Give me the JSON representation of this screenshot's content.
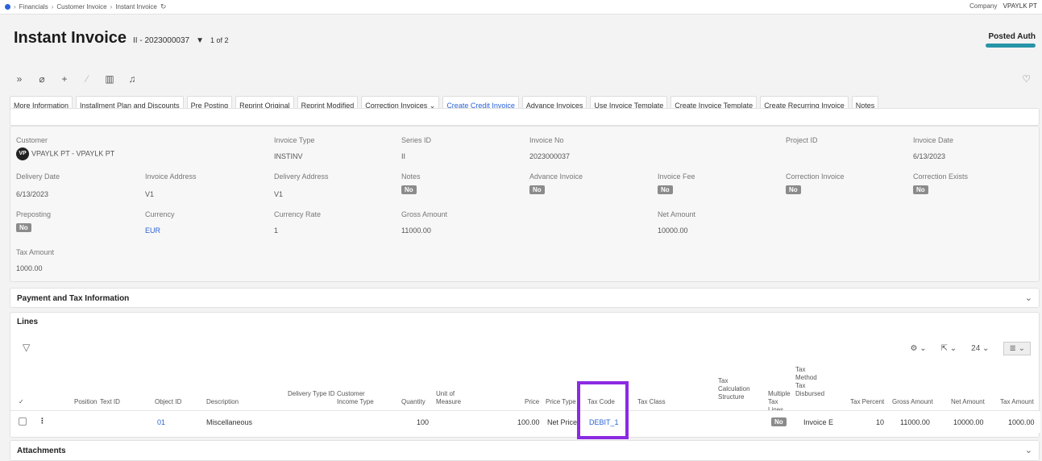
{
  "breadcrumb": {
    "items": [
      "Financials",
      "Customer Invoice",
      "Instant Invoice"
    ]
  },
  "company": {
    "label": "Company",
    "value": "VPAYLK PT"
  },
  "header": {
    "title": "Instant Invoice",
    "record": "II - 2023000037",
    "pager": "1 of 2",
    "status": "Posted Auth"
  },
  "commands": [
    "More Information",
    "Installment Plan and Discounts",
    "Pre Posting",
    "Reprint Original",
    "Reprint Modified",
    "Correction Invoices",
    "Create Credit Invoice",
    "Advance Invoices",
    "Use Invoice Template",
    "Create Invoice Template",
    "Create Recurring Invoice",
    "Notes"
  ],
  "fields": {
    "customer": {
      "label": "Customer",
      "value": "VPAYLK PT - VPAYLK PT",
      "avatar": "VP"
    },
    "invoice_type": {
      "label": "Invoice Type",
      "value": "INSTINV"
    },
    "series_id": {
      "label": "Series ID",
      "value": "II"
    },
    "invoice_no": {
      "label": "Invoice No",
      "value": "2023000037"
    },
    "project_id": {
      "label": "Project ID",
      "value": ""
    },
    "invoice_date": {
      "label": "Invoice Date",
      "value": "6/13/2023"
    },
    "delivery_date": {
      "label": "Delivery Date",
      "value": "6/13/2023"
    },
    "invoice_address": {
      "label": "Invoice Address",
      "value": "V1"
    },
    "delivery_address": {
      "label": "Delivery Address",
      "value": "V1"
    },
    "notes": {
      "label": "Notes",
      "value": "No"
    },
    "advance_invoice": {
      "label": "Advance Invoice",
      "value": "No"
    },
    "invoice_fee": {
      "label": "Invoice Fee",
      "value": "No"
    },
    "correction_invoice": {
      "label": "Correction Invoice",
      "value": "No"
    },
    "correction_exists": {
      "label": "Correction Exists",
      "value": "No"
    },
    "preposting": {
      "label": "Preposting",
      "value": "No"
    },
    "currency": {
      "label": "Currency",
      "value": "EUR"
    },
    "currency_rate": {
      "label": "Currency Rate",
      "value": "1"
    },
    "gross_amount": {
      "label": "Gross Amount",
      "value": "11000.00"
    },
    "net_amount": {
      "label": "Net Amount",
      "value": "10000.00"
    },
    "tax_amount": {
      "label": "Tax Amount",
      "value": "1000.00"
    }
  },
  "sections": {
    "payment": "Payment and Tax Information",
    "lines": "Lines",
    "attachments": "Attachments"
  },
  "lines_tools": {
    "page_size": "24"
  },
  "columns": {
    "position": "Position",
    "text_id": "Text ID",
    "object_id": "Object ID",
    "description": "Description",
    "delivery_type_id": "Delivery Type ID",
    "customer_income_type": "Customer Income Type",
    "quantity": "Quantity",
    "unit_of_measure": "Unit of Measure",
    "price": "Price",
    "price_type": "Price Type",
    "tax_code": "Tax Code",
    "tax_class": "Tax Class",
    "tax_calc_structure": "Tax Calculation Structure",
    "multiple_tax_lines": "Multiple Tax Lines",
    "tax_method_disbursed": "Tax Method Tax Disbursed",
    "tax_percent": "Tax Percent",
    "gross_amount": "Gross Amount",
    "net_amount": "Net Amount",
    "tax_amount": "Tax Amount"
  },
  "row": {
    "object_id": "01",
    "description": "Miscellaneous",
    "quantity": "100",
    "price": "100.00",
    "price_type": "Net Price",
    "tax_code": "DEBIT_1",
    "multiple_tax_lines": "No",
    "tax_method_disbursed": "Invoice E",
    "tax_percent": "10",
    "gross_amount": "11000.00",
    "net_amount": "10000.00",
    "tax_amount": "1000.00"
  }
}
